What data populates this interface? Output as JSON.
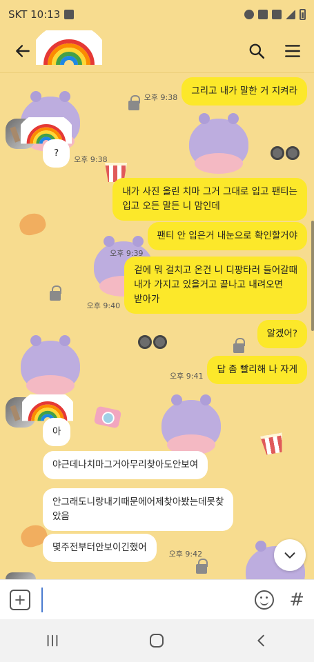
{
  "status_bar": {
    "carrier_time": "SKT 10:13",
    "indicator_icons": [
      "image-icon",
      "alarm-icon",
      "mute-icon",
      "5g-icon",
      "signal-icon",
      "battery-icon"
    ]
  },
  "header": {
    "back_icon": "back-arrow-icon",
    "avatar": "rainbow-avatar",
    "search_icon": "search-icon",
    "menu_icon": "hamburger-menu-icon"
  },
  "messages": [
    {
      "id": "m1",
      "direction": "out",
      "text": "그리고 내가 말한 거 지켜라",
      "time": "오후 9:38"
    },
    {
      "id": "m2",
      "direction": "in",
      "text": "?",
      "time": "오후 9:38"
    },
    {
      "id": "m3",
      "direction": "out",
      "text": "내가 사진 올린 치마 그거 그대로 입고 팬티는\n입고 오든 말든 니 맘인데",
      "time": ""
    },
    {
      "id": "m4",
      "direction": "out",
      "text": "팬티 안 입은거 내눈으로 확인할거야",
      "time": "오후 9:39"
    },
    {
      "id": "m5",
      "direction": "out",
      "text": "겉에 뭐 걸치고 온건 니 디팡타러 들어갈때\n내가 가지고 있을거고 끝나고 내려오면\n받아가",
      "time": "오후 9:40"
    },
    {
      "id": "m6",
      "direction": "out",
      "text": "알겠어?",
      "time": ""
    },
    {
      "id": "m7",
      "direction": "out",
      "text": "답 좀 빨리해 나 자게",
      "time": "오후 9:41"
    },
    {
      "id": "m8",
      "direction": "in",
      "text": "아",
      "time": ""
    },
    {
      "id": "m9",
      "direction": "in",
      "text": "야근데나치마그거아무리찾아도안보여",
      "time": ""
    },
    {
      "id": "m10",
      "direction": "in",
      "text": "안그래도니랑내기때문에어제찾아봤는데못찾\n았음",
      "time": ""
    },
    {
      "id": "m11",
      "direction": "in",
      "text": "몇주전부터안보이긴했어",
      "time": "오후 9:42"
    }
  ],
  "input_bar": {
    "plus_icon": "plus-icon",
    "placeholder": "",
    "emoji_icon": "emoji-icon",
    "hash_symbol": "#"
  },
  "nav_bar": {
    "recent_icon": "recent-apps-icon",
    "home_icon": "home-icon",
    "back_icon": "nav-back-icon"
  },
  "colors": {
    "background": "#f7dc8f",
    "outgoing_bubble": "#fce82a",
    "incoming_bubble": "#ffffff"
  }
}
